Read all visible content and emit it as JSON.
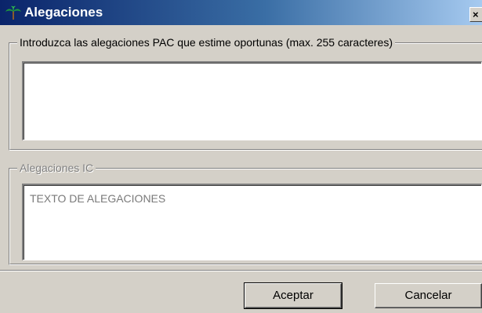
{
  "window": {
    "title": "Alegaciones",
    "close_glyph": "×",
    "icon": "palm-tree-icon"
  },
  "pac_group": {
    "legend": "Introduzca las alegaciones PAC que estime oportunas (max. 255 caracteres)",
    "value": ""
  },
  "ic_group": {
    "legend": "Alegaciones IC",
    "value": "TEXTO DE ALEGACIONES",
    "enabled": false
  },
  "buttons": {
    "accept_label": "Aceptar",
    "cancel_label": "Cancelar"
  },
  "colors": {
    "titlebar_start": "#0a246a",
    "titlebar_end": "#a6caf0",
    "face": "#d4d0c8"
  }
}
